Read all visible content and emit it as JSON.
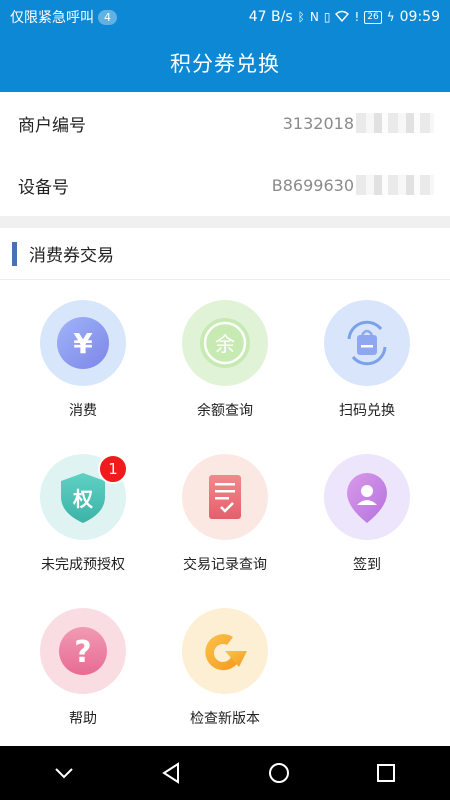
{
  "status_bar": {
    "carrier": "仅限紧急呼叫",
    "notification_count": "4",
    "network_speed": "47 B/s",
    "battery": "26",
    "time": "09:59"
  },
  "header": {
    "title": "积分券兑换"
  },
  "info": {
    "merchant_label": "商户编号",
    "merchant_value": "3132018",
    "device_label": "设备号",
    "device_value": "B8699630"
  },
  "section": {
    "title": "消费券交易"
  },
  "grid": {
    "items": [
      {
        "label": "消费",
        "icon": "yen-icon"
      },
      {
        "label": "余额查询",
        "icon": "balance-icon"
      },
      {
        "label": "扫码兑换",
        "icon": "scan-exchange-icon"
      },
      {
        "label": "未完成预授权",
        "icon": "shield-icon",
        "glyph": "权",
        "badge": "1"
      },
      {
        "label": "交易记录查询",
        "icon": "record-icon"
      },
      {
        "label": "签到",
        "icon": "checkin-icon"
      },
      {
        "label": "帮助",
        "icon": "help-icon",
        "glyph": "?"
      },
      {
        "label": "检查新版本",
        "icon": "update-icon"
      }
    ],
    "yen_glyph": "¥",
    "balance_glyph": "余"
  },
  "colors": {
    "brand": "#0d88d4",
    "accent_bar": "#4a6fb3",
    "badge": "#f21b1b"
  }
}
